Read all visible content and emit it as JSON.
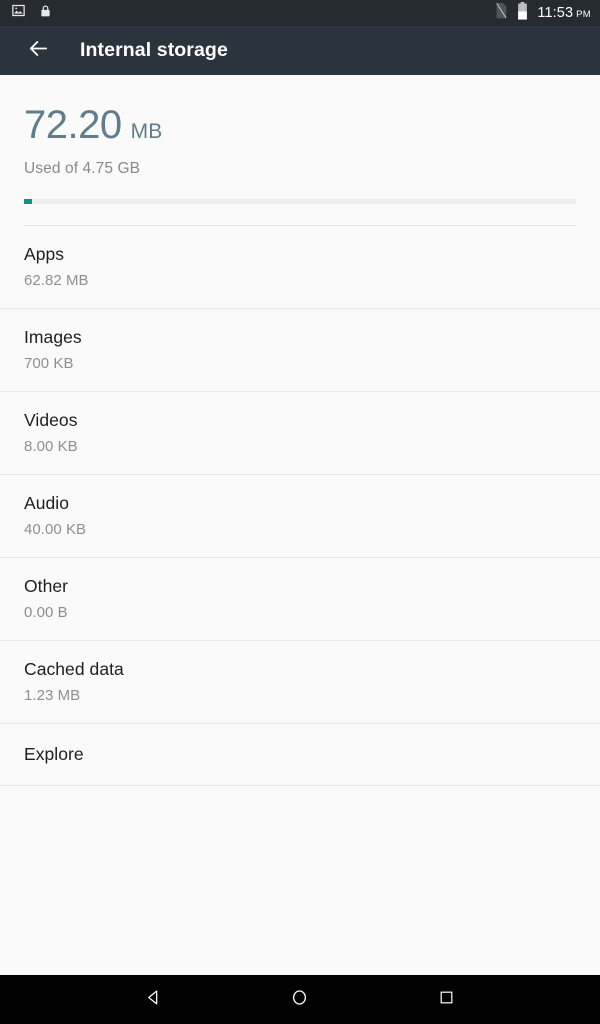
{
  "status_bar": {
    "left_icons": [
      {
        "name": "screenshot-image-icon",
        "glyph": "image"
      },
      {
        "name": "screen-lock-icon",
        "glyph": "lock"
      }
    ],
    "right_icons": [
      {
        "name": "no-sim-card-icon",
        "glyph": "sim-off"
      },
      {
        "name": "battery-icon",
        "glyph": "battery-half"
      }
    ],
    "time": "11:53",
    "meridiem": "PM",
    "background_color": "#252b31"
  },
  "action_bar": {
    "back_icon": "arrow-back-icon",
    "title": "Internal storage",
    "background_color": "#2b333c"
  },
  "summary": {
    "used_value": "72.20",
    "used_unit": "MB",
    "caption": "Used of 4.75 GB",
    "progress_percent": 1.5,
    "progress_color": "#0d9488",
    "track_color": "#ededef",
    "amount_color": "#5f7d8c"
  },
  "storage_items": [
    {
      "name": "apps",
      "title": "Apps",
      "size": "62.82 MB"
    },
    {
      "name": "images",
      "title": "Images",
      "size": "700 KB"
    },
    {
      "name": "videos",
      "title": "Videos",
      "size": "8.00 KB"
    },
    {
      "name": "audio",
      "title": "Audio",
      "size": "40.00 KB"
    },
    {
      "name": "other",
      "title": "Other",
      "size": "0.00 B"
    },
    {
      "name": "cached-data",
      "title": "Cached data",
      "size": "1.23 MB"
    },
    {
      "name": "explore",
      "title": "Explore",
      "size": null
    }
  ],
  "nav_bar": {
    "buttons": [
      {
        "name": "nav-back-button",
        "glyph": "triangle-left"
      },
      {
        "name": "nav-home-button",
        "glyph": "circle"
      },
      {
        "name": "nav-recents-button",
        "glyph": "square"
      }
    ],
    "background_color": "#000000"
  }
}
